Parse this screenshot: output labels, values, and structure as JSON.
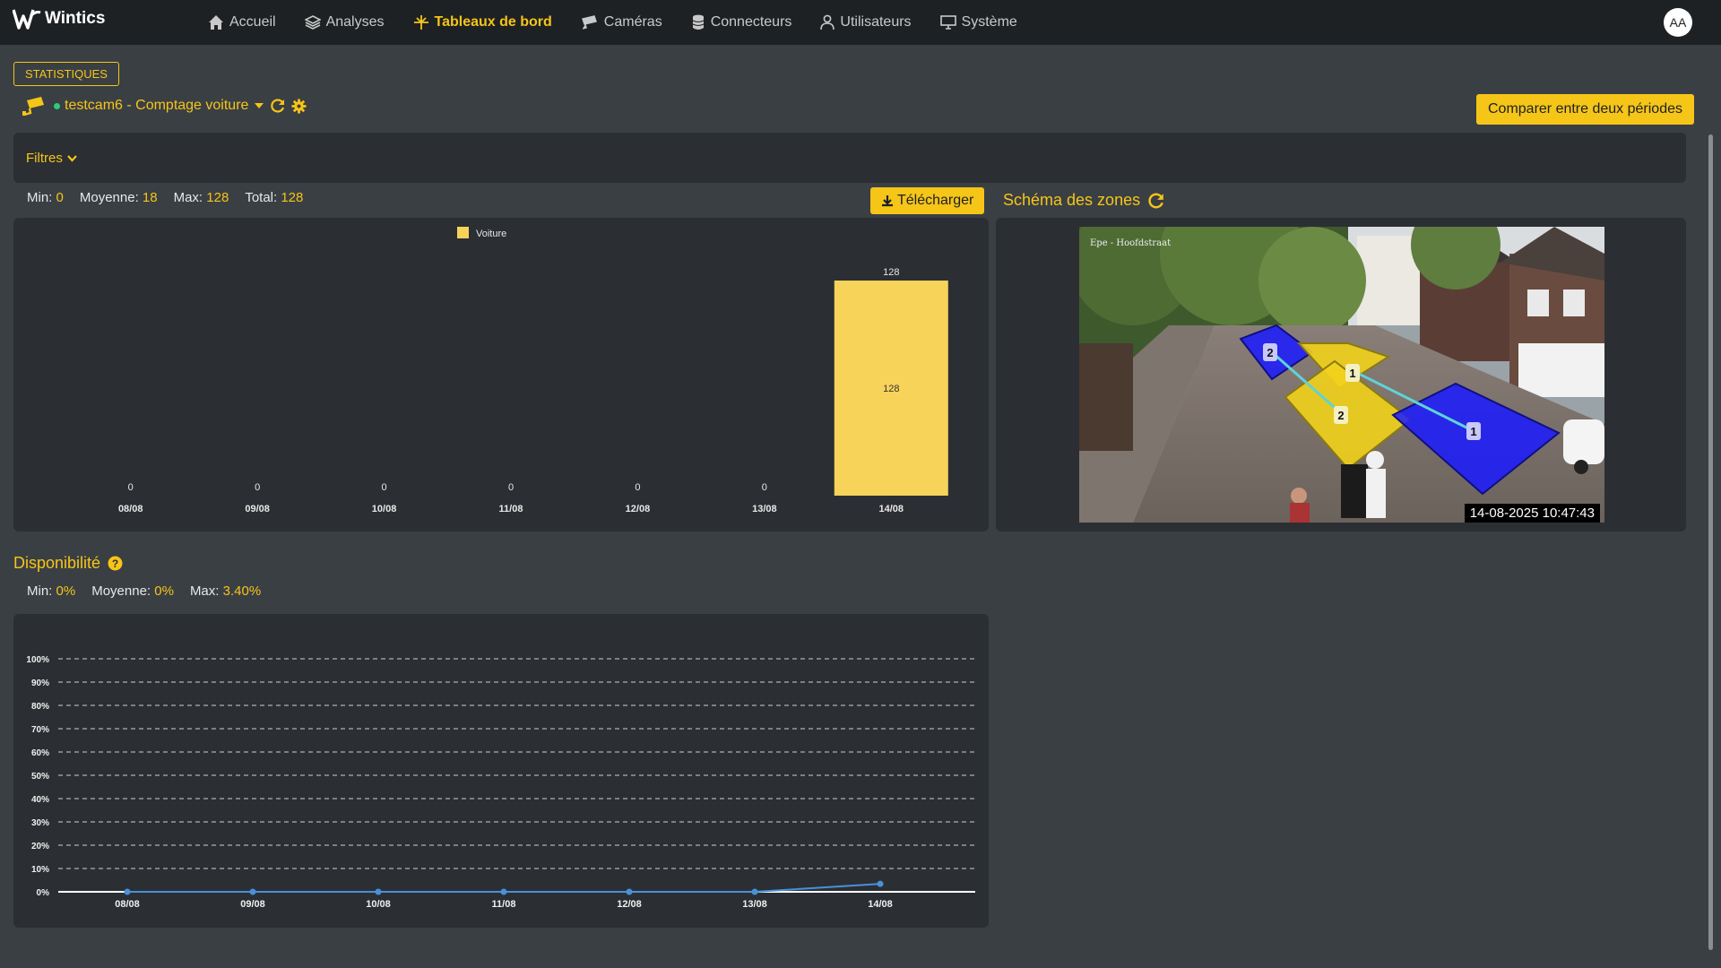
{
  "app": {
    "name": "Wintics"
  },
  "nav": [
    {
      "label": "Accueil",
      "icon": "home-icon"
    },
    {
      "label": "Analyses",
      "icon": "layers-icon"
    },
    {
      "label": "Tableaux de bord",
      "icon": "dashboard-icon",
      "active": true
    },
    {
      "label": "Caméras",
      "icon": "camera-icon"
    },
    {
      "label": "Connecteurs",
      "icon": "database-icon"
    },
    {
      "label": "Utilisateurs",
      "icon": "user-icon"
    },
    {
      "label": "Système",
      "icon": "monitor-icon"
    }
  ],
  "user": {
    "initials": "AA"
  },
  "header": {
    "badge": "STATISTIQUES",
    "camera": "testcam6 - Comptage voiture",
    "compare_label": "Comparer entre deux périodes"
  },
  "filters": {
    "label": "Filtres"
  },
  "stats": {
    "min_label": "Min:",
    "min": "0",
    "avg_label": "Moyenne:",
    "avg": "18",
    "max_label": "Max:",
    "max": "128",
    "total_label": "Total:",
    "total": "128"
  },
  "download_label": "Télécharger",
  "zones": {
    "title": "Schéma des zones",
    "timestamp": "14-08-2025 10:47:43",
    "overlay_text": "Epe - Hoofdstraat"
  },
  "availability": {
    "title": "Disponibilité",
    "min_label": "Min:",
    "min": "0%",
    "avg_label": "Moyenne:",
    "avg": "0%",
    "max_label": "Max:",
    "max": "3.40%"
  },
  "colors": {
    "accent": "#f5c518",
    "bar": "#f7d35a",
    "line": "#4a90d9",
    "zone_blue": "#1a1aff",
    "zone_yellow": "#f2d21b"
  },
  "chart_data": [
    {
      "type": "bar",
      "categories": [
        "08/08",
        "09/08",
        "10/08",
        "11/08",
        "12/08",
        "13/08",
        "14/08"
      ],
      "series": [
        {
          "name": "Voiture",
          "values": [
            0,
            0,
            0,
            0,
            0,
            0,
            128
          ]
        }
      ],
      "ylim": [
        0,
        128
      ],
      "legend": "top"
    },
    {
      "type": "line",
      "categories": [
        "08/08",
        "09/08",
        "10/08",
        "11/08",
        "12/08",
        "13/08",
        "14/08"
      ],
      "series": [
        {
          "values": [
            0,
            0,
            0,
            0,
            0,
            0,
            3.4
          ]
        }
      ],
      "yticks": [
        "0%",
        "10%",
        "20%",
        "30%",
        "40%",
        "50%",
        "60%",
        "70%",
        "80%",
        "90%",
        "100%"
      ],
      "ylim": [
        0,
        100
      ],
      "grid": true
    }
  ]
}
